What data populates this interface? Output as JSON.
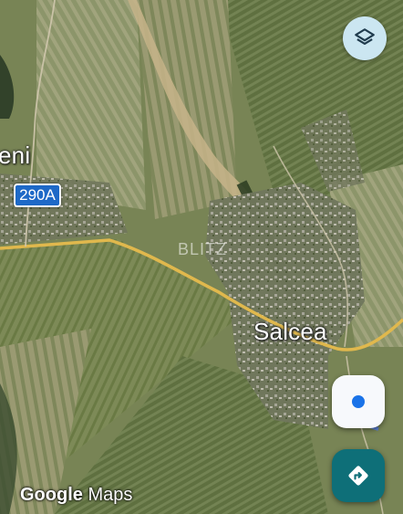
{
  "map": {
    "type": "satellite",
    "provider": "Google Maps"
  },
  "labels": {
    "town_left": "eni",
    "town_right": "Salcea",
    "route_shield": "290A",
    "watermark": "BLITZ"
  },
  "attribution": {
    "google": "Google",
    "maps": "Maps"
  },
  "controls": {
    "layers_icon": "layers-icon",
    "location_icon": "my-location-icon",
    "directions_icon": "directions-icon"
  },
  "colors": {
    "road": "#e0b84d",
    "route_shield": "#1e69c7",
    "layers_button": "#cbe6f1",
    "directions_button": "#0e6f78",
    "location_dot": "#1a73e8"
  }
}
